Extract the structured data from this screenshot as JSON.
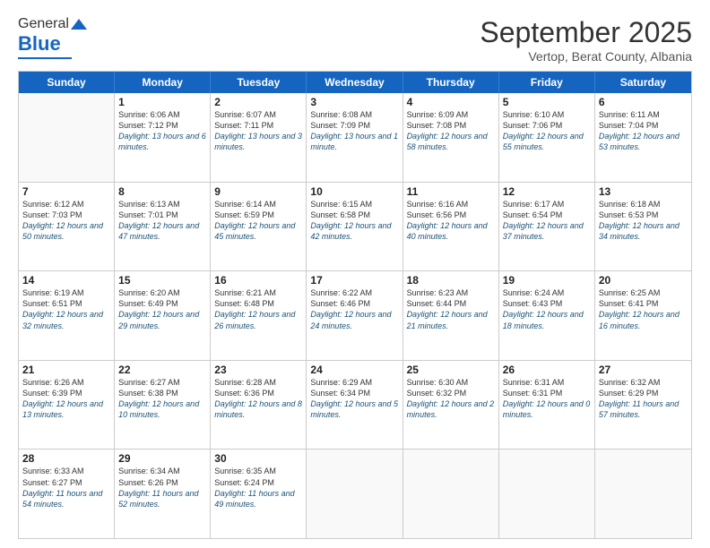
{
  "header": {
    "logo_general": "General",
    "logo_blue": "Blue",
    "month_title": "September 2025",
    "location": "Vertop, Berat County, Albania"
  },
  "weekdays": [
    "Sunday",
    "Monday",
    "Tuesday",
    "Wednesday",
    "Thursday",
    "Friday",
    "Saturday"
  ],
  "weeks": [
    [
      {
        "day": "",
        "sunrise": "",
        "sunset": "",
        "daylight": ""
      },
      {
        "day": "1",
        "sunrise": "Sunrise: 6:06 AM",
        "sunset": "Sunset: 7:12 PM",
        "daylight": "Daylight: 13 hours and 6 minutes."
      },
      {
        "day": "2",
        "sunrise": "Sunrise: 6:07 AM",
        "sunset": "Sunset: 7:11 PM",
        "daylight": "Daylight: 13 hours and 3 minutes."
      },
      {
        "day": "3",
        "sunrise": "Sunrise: 6:08 AM",
        "sunset": "Sunset: 7:09 PM",
        "daylight": "Daylight: 13 hours and 1 minute."
      },
      {
        "day": "4",
        "sunrise": "Sunrise: 6:09 AM",
        "sunset": "Sunset: 7:08 PM",
        "daylight": "Daylight: 12 hours and 58 minutes."
      },
      {
        "day": "5",
        "sunrise": "Sunrise: 6:10 AM",
        "sunset": "Sunset: 7:06 PM",
        "daylight": "Daylight: 12 hours and 55 minutes."
      },
      {
        "day": "6",
        "sunrise": "Sunrise: 6:11 AM",
        "sunset": "Sunset: 7:04 PM",
        "daylight": "Daylight: 12 hours and 53 minutes."
      }
    ],
    [
      {
        "day": "7",
        "sunrise": "Sunrise: 6:12 AM",
        "sunset": "Sunset: 7:03 PM",
        "daylight": "Daylight: 12 hours and 50 minutes."
      },
      {
        "day": "8",
        "sunrise": "Sunrise: 6:13 AM",
        "sunset": "Sunset: 7:01 PM",
        "daylight": "Daylight: 12 hours and 47 minutes."
      },
      {
        "day": "9",
        "sunrise": "Sunrise: 6:14 AM",
        "sunset": "Sunset: 6:59 PM",
        "daylight": "Daylight: 12 hours and 45 minutes."
      },
      {
        "day": "10",
        "sunrise": "Sunrise: 6:15 AM",
        "sunset": "Sunset: 6:58 PM",
        "daylight": "Daylight: 12 hours and 42 minutes."
      },
      {
        "day": "11",
        "sunrise": "Sunrise: 6:16 AM",
        "sunset": "Sunset: 6:56 PM",
        "daylight": "Daylight: 12 hours and 40 minutes."
      },
      {
        "day": "12",
        "sunrise": "Sunrise: 6:17 AM",
        "sunset": "Sunset: 6:54 PM",
        "daylight": "Daylight: 12 hours and 37 minutes."
      },
      {
        "day": "13",
        "sunrise": "Sunrise: 6:18 AM",
        "sunset": "Sunset: 6:53 PM",
        "daylight": "Daylight: 12 hours and 34 minutes."
      }
    ],
    [
      {
        "day": "14",
        "sunrise": "Sunrise: 6:19 AM",
        "sunset": "Sunset: 6:51 PM",
        "daylight": "Daylight: 12 hours and 32 minutes."
      },
      {
        "day": "15",
        "sunrise": "Sunrise: 6:20 AM",
        "sunset": "Sunset: 6:49 PM",
        "daylight": "Daylight: 12 hours and 29 minutes."
      },
      {
        "day": "16",
        "sunrise": "Sunrise: 6:21 AM",
        "sunset": "Sunset: 6:48 PM",
        "daylight": "Daylight: 12 hours and 26 minutes."
      },
      {
        "day": "17",
        "sunrise": "Sunrise: 6:22 AM",
        "sunset": "Sunset: 6:46 PM",
        "daylight": "Daylight: 12 hours and 24 minutes."
      },
      {
        "day": "18",
        "sunrise": "Sunrise: 6:23 AM",
        "sunset": "Sunset: 6:44 PM",
        "daylight": "Daylight: 12 hours and 21 minutes."
      },
      {
        "day": "19",
        "sunrise": "Sunrise: 6:24 AM",
        "sunset": "Sunset: 6:43 PM",
        "daylight": "Daylight: 12 hours and 18 minutes."
      },
      {
        "day": "20",
        "sunrise": "Sunrise: 6:25 AM",
        "sunset": "Sunset: 6:41 PM",
        "daylight": "Daylight: 12 hours and 16 minutes."
      }
    ],
    [
      {
        "day": "21",
        "sunrise": "Sunrise: 6:26 AM",
        "sunset": "Sunset: 6:39 PM",
        "daylight": "Daylight: 12 hours and 13 minutes."
      },
      {
        "day": "22",
        "sunrise": "Sunrise: 6:27 AM",
        "sunset": "Sunset: 6:38 PM",
        "daylight": "Daylight: 12 hours and 10 minutes."
      },
      {
        "day": "23",
        "sunrise": "Sunrise: 6:28 AM",
        "sunset": "Sunset: 6:36 PM",
        "daylight": "Daylight: 12 hours and 8 minutes."
      },
      {
        "day": "24",
        "sunrise": "Sunrise: 6:29 AM",
        "sunset": "Sunset: 6:34 PM",
        "daylight": "Daylight: 12 hours and 5 minutes."
      },
      {
        "day": "25",
        "sunrise": "Sunrise: 6:30 AM",
        "sunset": "Sunset: 6:32 PM",
        "daylight": "Daylight: 12 hours and 2 minutes."
      },
      {
        "day": "26",
        "sunrise": "Sunrise: 6:31 AM",
        "sunset": "Sunset: 6:31 PM",
        "daylight": "Daylight: 12 hours and 0 minutes."
      },
      {
        "day": "27",
        "sunrise": "Sunrise: 6:32 AM",
        "sunset": "Sunset: 6:29 PM",
        "daylight": "Daylight: 11 hours and 57 minutes."
      }
    ],
    [
      {
        "day": "28",
        "sunrise": "Sunrise: 6:33 AM",
        "sunset": "Sunset: 6:27 PM",
        "daylight": "Daylight: 11 hours and 54 minutes."
      },
      {
        "day": "29",
        "sunrise": "Sunrise: 6:34 AM",
        "sunset": "Sunset: 6:26 PM",
        "daylight": "Daylight: 11 hours and 52 minutes."
      },
      {
        "day": "30",
        "sunrise": "Sunrise: 6:35 AM",
        "sunset": "Sunset: 6:24 PM",
        "daylight": "Daylight: 11 hours and 49 minutes."
      },
      {
        "day": "",
        "sunrise": "",
        "sunset": "",
        "daylight": ""
      },
      {
        "day": "",
        "sunrise": "",
        "sunset": "",
        "daylight": ""
      },
      {
        "day": "",
        "sunrise": "",
        "sunset": "",
        "daylight": ""
      },
      {
        "day": "",
        "sunrise": "",
        "sunset": "",
        "daylight": ""
      }
    ]
  ]
}
